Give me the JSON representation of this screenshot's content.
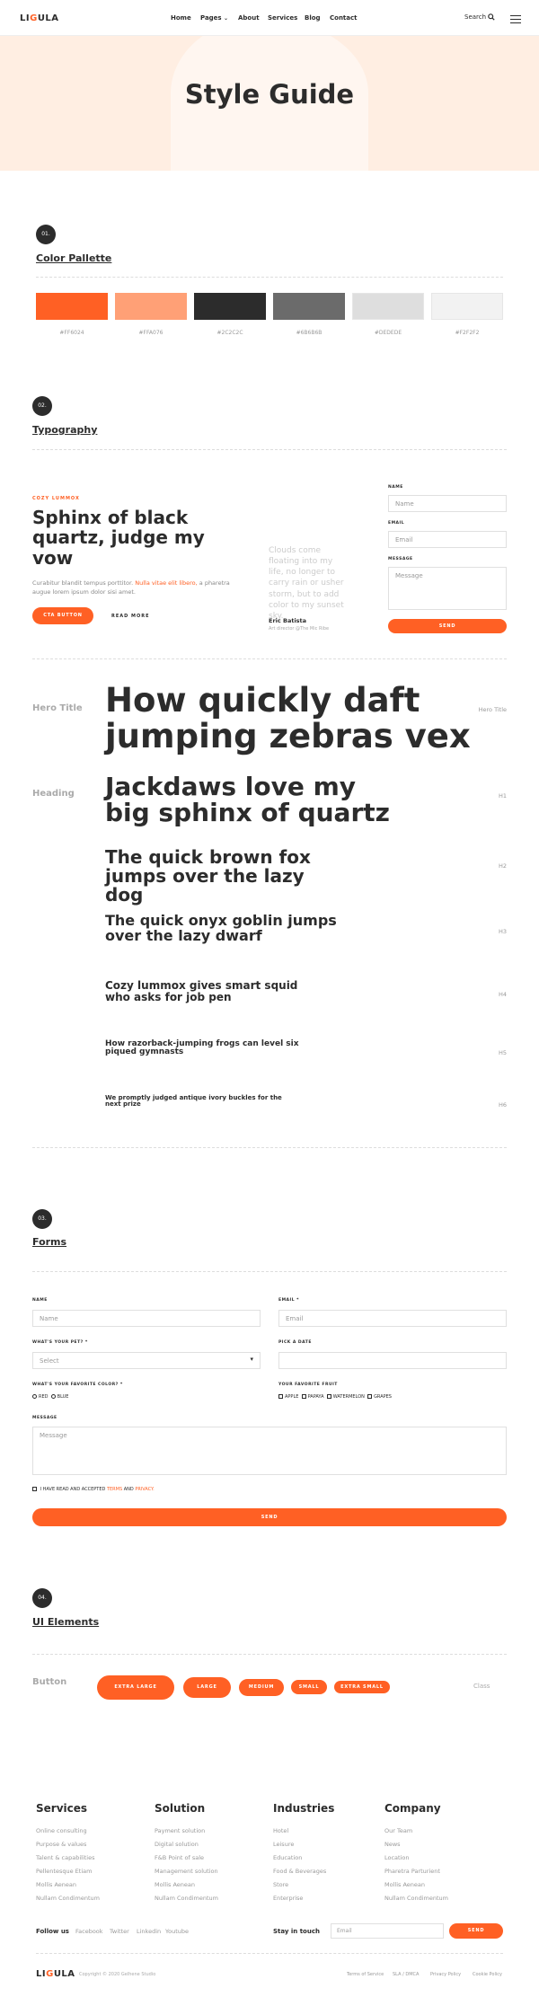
{
  "header": {
    "logo_left": "LI",
    "logo_accent": "G",
    "logo_right": "ULA",
    "nav": [
      "Home",
      "Pages",
      "About",
      "Services",
      "Blog",
      "Contact"
    ],
    "search_label": "Search"
  },
  "hero": {
    "title": "Style Guide"
  },
  "sections": {
    "s1": {
      "num": "01.",
      "title": "Color Pallette"
    },
    "s2": {
      "num": "02.",
      "title": "Typography"
    },
    "s3": {
      "num": "03.",
      "title": "Forms"
    },
    "s4": {
      "num": "04.",
      "title": "UI Elements"
    }
  },
  "colors": [
    {
      "hex": "#FF6024",
      "label": "#FF6024"
    },
    {
      "hex": "#FFA076",
      "label": "#FFA076"
    },
    {
      "hex": "#2C2C2C",
      "label": "#2C2C2C"
    },
    {
      "hex": "#6B6B6B",
      "label": "#6B6B6B"
    },
    {
      "hex": "#DEDEDE",
      "label": "#DEDEDE"
    },
    {
      "hex": "#F2F2F2",
      "label": "#F2F2F2"
    }
  ],
  "typo": {
    "overline": "COZY LUMMOX",
    "heading": "Sphinx of black quartz, judge my vow",
    "body_pre": "Curabitur blandit tempus porttitor.",
    "body_link": "Nulla vitae elit libero,",
    "body_post": "a pharetra augue lorem ipsum dolor sisi amet.",
    "cta": "CTA BUTTON",
    "read_more": "READ MORE",
    "quote": "Clouds come floating into my life, no longer to carry rain or usher storm, but to add color to my sunset sky.",
    "author": "Eric Batista",
    "author_role": "Art director @The Mic Ribe",
    "form": {
      "name_label": "NAME",
      "name_ph": "Name",
      "email_label": "EMAIL",
      "email_ph": "Email",
      "message_label": "MESSAGE",
      "message_ph": "Message",
      "send": "SEND"
    }
  },
  "headings": [
    {
      "label": "Hero Title",
      "text": "How quickly daft jumping zebras vex",
      "tag": "Hero Title"
    },
    {
      "label": "Heading",
      "text": "Jackdaws love my big sphinx of quartz",
      "tag": "H1"
    },
    {
      "label": "",
      "text": "The quick brown fox jumps over the lazy dog",
      "tag": "H2"
    },
    {
      "label": "",
      "text": "The quick onyx goblin jumps over the lazy dwarf",
      "tag": "H3"
    },
    {
      "label": "",
      "text": "Cozy lummox gives smart squid who asks for job pen",
      "tag": "H4"
    },
    {
      "label": "",
      "text": "How razorback-jumping frogs can level six piqued gymnasts",
      "tag": "H5"
    },
    {
      "label": "",
      "text": "We promptly judged antique ivory buckles for the next prize",
      "tag": "H6"
    }
  ],
  "forms": {
    "name_label": "NAME",
    "name_ph": "Name",
    "email_label": "EMAIL *",
    "email_ph": "Email",
    "pet_label": "WHAT'S YOUR PET? *",
    "pet_value": "Select",
    "date_label": "PICK A DATE",
    "color_label": "WHAT'S YOUR FAVORITE COLOR? *",
    "colors": [
      "RED",
      "BLUE"
    ],
    "fruit_label": "YOUR FAVORITE FRUIT",
    "fruits": [
      "APPLE",
      "PAPAYA",
      "WATERMELON",
      "GRAPES"
    ],
    "message_label": "MESSAGE",
    "message_ph": "Message",
    "agree_pre": "I HAVE READ AND ACCEPTED",
    "terms": "TERMS",
    "and": "AND",
    "privacy": "PRIVACY.",
    "send": "SEND"
  },
  "ui": {
    "button_label": "Button",
    "buttons": [
      "EXTRA LARGE",
      "LARGE",
      "MEDIUM",
      "SMALL",
      "EXTRA SMALL"
    ],
    "class_label": "Class"
  },
  "footer": {
    "columns": [
      {
        "title": "Services",
        "items": [
          "Online consulting",
          "Purpose & values",
          "Talent & capabilities",
          "Pellentesque Etiam",
          "Mollis Aenean",
          "Nullam Condimentum"
        ]
      },
      {
        "title": "Solution",
        "items": [
          "Payment solution",
          "Digital solution",
          "F&B Point of sale",
          "Management solution",
          "Mollis Aenean",
          "Nullam Condimentum"
        ]
      },
      {
        "title": "Industries",
        "items": [
          "Hotel",
          "Leisure",
          "Education",
          "Food & Beverages",
          "Store",
          "Enterprise"
        ]
      },
      {
        "title": "Company",
        "items": [
          "Our Team",
          "News",
          "Location",
          "Pharetra Parturient",
          "Mollis Aenean",
          "Nullam Condimentum"
        ]
      }
    ],
    "follow_label": "Follow us",
    "socials": [
      "Facebook",
      "Twitter",
      "Linkedin",
      "Youtube"
    ],
    "stay_label": "Stay in touch",
    "email_ph": "Email",
    "send": "SEND",
    "copyright": "Copyright © 2020 Gelhene Studio",
    "links": [
      "Terms of Service",
      "SLA / DMCA",
      "Privacy Policy",
      "Cookie Policy"
    ]
  }
}
